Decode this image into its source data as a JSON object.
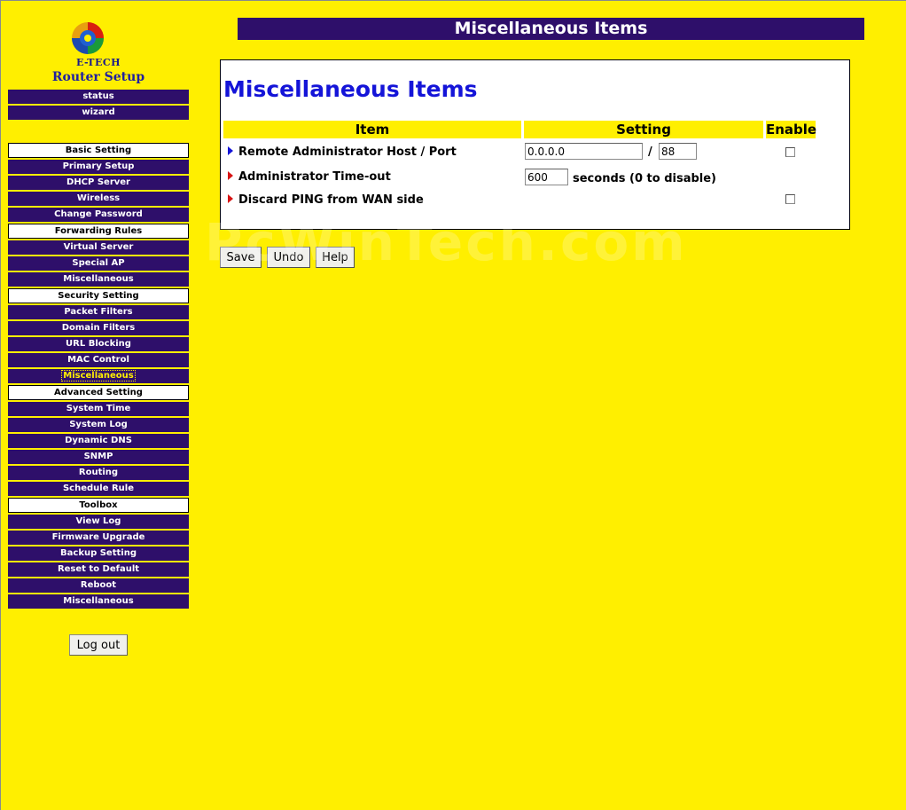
{
  "logo": {
    "brand": "E-TECH",
    "subtitle": "Router Setup"
  },
  "sidebar": {
    "items": [
      {
        "label": "status",
        "type": "link"
      },
      {
        "label": "wizard",
        "type": "link"
      },
      {
        "label": "Basic Setting",
        "type": "section"
      },
      {
        "label": "Primary Setup",
        "type": "link"
      },
      {
        "label": "DHCP Server",
        "type": "link"
      },
      {
        "label": "Wireless",
        "type": "link"
      },
      {
        "label": "Change Password",
        "type": "link"
      },
      {
        "label": "Forwarding Rules",
        "type": "section"
      },
      {
        "label": "Virtual Server",
        "type": "link"
      },
      {
        "label": "Special AP",
        "type": "link"
      },
      {
        "label": "Miscellaneous",
        "type": "link"
      },
      {
        "label": "Security Setting",
        "type": "section"
      },
      {
        "label": "Packet Filters",
        "type": "link"
      },
      {
        "label": "Domain Filters",
        "type": "link"
      },
      {
        "label": "URL Blocking",
        "type": "link"
      },
      {
        "label": "MAC Control",
        "type": "link"
      },
      {
        "label": "Miscellaneous",
        "type": "link",
        "active": true
      },
      {
        "label": "Advanced Setting",
        "type": "section"
      },
      {
        "label": "System Time",
        "type": "link"
      },
      {
        "label": "System Log",
        "type": "link"
      },
      {
        "label": "Dynamic DNS",
        "type": "link"
      },
      {
        "label": "SNMP",
        "type": "link"
      },
      {
        "label": "Routing",
        "type": "link"
      },
      {
        "label": "Schedule Rule",
        "type": "link"
      },
      {
        "label": "Toolbox",
        "type": "section"
      },
      {
        "label": "View Log",
        "type": "link"
      },
      {
        "label": "Firmware Upgrade",
        "type": "link"
      },
      {
        "label": "Backup Setting",
        "type": "link"
      },
      {
        "label": "Reset to Default",
        "type": "link"
      },
      {
        "label": "Reboot",
        "type": "link"
      },
      {
        "label": "Miscellaneous",
        "type": "link"
      }
    ],
    "logout_label": "Log out"
  },
  "header": {
    "title": "Miscellaneous Items"
  },
  "panel": {
    "title": "Miscellaneous Items",
    "columns": {
      "item": "Item",
      "setting": "Setting",
      "enable": "Enable"
    },
    "rows": {
      "remote": {
        "label": "Remote Administrator Host / Port",
        "host": "0.0.0.0",
        "separator": "/",
        "port": "88",
        "enabled": false
      },
      "timeout": {
        "label": "Administrator Time-out",
        "value": "600",
        "hint": "seconds (0 to disable)"
      },
      "ping": {
        "label": "Discard PING from WAN side",
        "enabled": false
      }
    }
  },
  "buttons": {
    "save": "Save",
    "undo": "Undo",
    "help": "Help"
  },
  "watermark": "PcWinTech.com",
  "colors": {
    "background": "#ffef00",
    "nav": "#2e0f6a",
    "title": "#1414d8",
    "arrow_blue": "#1414d8",
    "arrow_red": "#d81414"
  }
}
